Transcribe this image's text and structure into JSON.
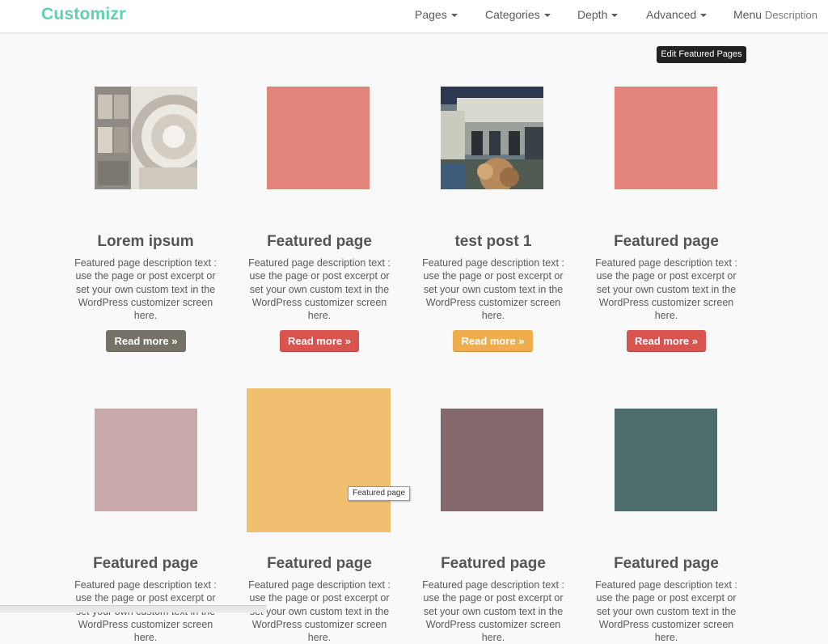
{
  "header": {
    "brand": "Customizr",
    "nav": [
      {
        "label": "Pages",
        "has_caret": true
      },
      {
        "label": "Categories",
        "has_caret": true
      },
      {
        "label": "Depth",
        "has_caret": true
      },
      {
        "label": "Advanced",
        "has_caret": true
      },
      {
        "label": "Menu",
        "desc": "Description"
      }
    ]
  },
  "edit_featured_label": "Edit Featured Pages",
  "hover_tooltip": "Featured page",
  "cards": [
    {
      "title": "Lorem ipsum",
      "desc": "Featured page description text : use the page or post excerpt or set your own custom text in the WordPress customizer screen here.",
      "button": "Read more »",
      "button_color": "#777268",
      "thumb_color": "#cfc8bd"
    },
    {
      "title": "Featured page",
      "desc": "Featured page description text : use the page or post excerpt or set your own custom text in the WordPress customizer screen here.",
      "button": "Read more »",
      "button_color": "#d9534f",
      "thumb_color": "#e2847b"
    },
    {
      "title": "test post 1",
      "desc": "Featured page description text : use the page or post excerpt or set your own custom text in the WordPress customizer screen here.",
      "button": "Read more »",
      "button_color": "#f0ad4e",
      "thumb_color": "#7b8a7a"
    },
    {
      "title": "Featured page",
      "desc": "Featured page description text : use the page or post excerpt or set your own custom text in the WordPress customizer screen here.",
      "button": "Read more »",
      "button_color": "#d9534f",
      "thumb_color": "#e2847b"
    },
    {
      "title": "Featured page",
      "desc": "Featured page description text : use the page or post excerpt or set your own custom text in the WordPress customizer screen here.",
      "thumb_color": "#c8a8a9"
    },
    {
      "title": "Featured page",
      "desc": "Featured page description text : use the page or post excerpt or set your own custom text in the WordPress customizer screen here.",
      "thumb_color": "#f0c070"
    },
    {
      "title": "Featured page",
      "desc": "Featured page description text : use the page or post excerpt or set your own custom text in the WordPress customizer screen here.",
      "thumb_color": "#83686c"
    },
    {
      "title": "Featured page",
      "desc": "Featured page description text : use the page or post excerpt or set your own custom text in the WordPress customizer screen here.",
      "thumb_color": "#4f6d6b"
    }
  ]
}
